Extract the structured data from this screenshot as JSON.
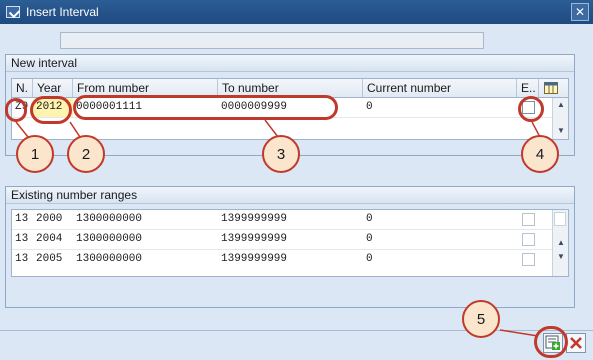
{
  "window": {
    "title": "Insert Interval"
  },
  "new_interval": {
    "title": "New interval",
    "headers": [
      "N.",
      "Year",
      "From number",
      "To number",
      "Current number",
      "E.."
    ],
    "row": {
      "no": "Z9",
      "year": "2012",
      "from": "0000001111",
      "to": "0000009999",
      "current": "0"
    }
  },
  "existing": {
    "title": "Existing number ranges",
    "rows": [
      {
        "no": "13",
        "year": "2000",
        "from": "1300000000",
        "to": "1399999999",
        "current": "0"
      },
      {
        "no": "13",
        "year": "2004",
        "from": "1300000000",
        "to": "1399999999",
        "current": "0"
      },
      {
        "no": "13",
        "year": "2005",
        "from": "1300000000",
        "to": "1399999999",
        "current": "0"
      }
    ]
  },
  "callouts": [
    "1",
    "2",
    "3",
    "4",
    "5"
  ],
  "colors": {
    "annotation_red": "#c0392b",
    "callout_fill": "#fbe6cd",
    "titlebar": "#1e4a7f"
  },
  "icons": [
    "close-icon",
    "column-settings-icon",
    "insert-icon",
    "cancel-icon"
  ]
}
